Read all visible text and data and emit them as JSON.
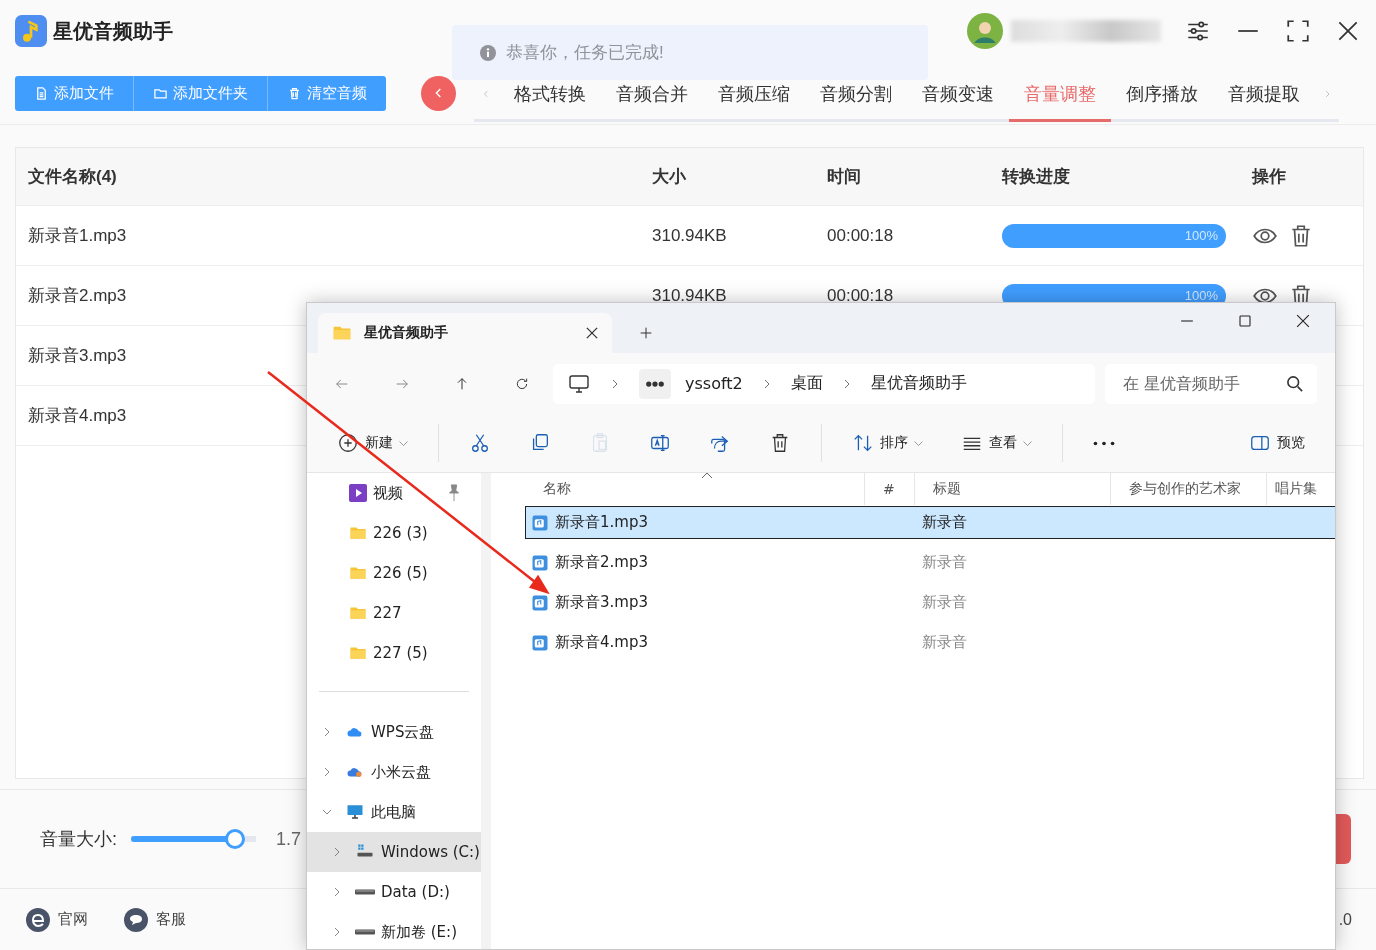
{
  "app": {
    "title": "星优音频助手",
    "toast": "恭喜你，任务已完成!",
    "actions": [
      {
        "label": "添加文件",
        "kind": "file"
      },
      {
        "label": "添加文件夹",
        "kind": "folder"
      },
      {
        "label": "清空音频",
        "kind": "trash"
      }
    ],
    "tabs": [
      {
        "label": "格式转换",
        "selected": false
      },
      {
        "label": "音频合并",
        "selected": false
      },
      {
        "label": "音频压缩",
        "selected": false
      },
      {
        "label": "音频分割",
        "selected": false
      },
      {
        "label": "音频变速",
        "selected": false
      },
      {
        "label": "音量调整",
        "selected": true
      },
      {
        "label": "倒序播放",
        "selected": false
      },
      {
        "label": "音频提取",
        "selected": false
      }
    ],
    "table": {
      "columns": [
        "文件名称(4)",
        "大小",
        "时间",
        "转换进度",
        "操作"
      ],
      "rows": [
        {
          "name": "新录音1.mp3",
          "size": "310.94KB",
          "time": "00:00:18",
          "progress": "100%",
          "level": 1
        },
        {
          "name": "新录音2.mp3",
          "size": "310.94KB",
          "time": "00:00:18",
          "progress": "100%",
          "level": 1
        },
        {
          "name": "新录音3.mp3"
        },
        {
          "name": "新录音4.mp3"
        }
      ]
    },
    "volume": {
      "label": "音量大小:",
      "level": 0.83,
      "reading": "1.7"
    },
    "footer": {
      "links": [
        {
          "label": "官网",
          "kind": "web"
        },
        {
          "label": "客服",
          "kind": "chat"
        }
      ],
      "version": ".0"
    }
  },
  "explorer": {
    "tab_title": "星优音频助手",
    "breadcrumb": [
      "yssoft2",
      "桌面",
      "星优音频助手"
    ],
    "search": {
      "placeholder": "在 星优音频助手"
    },
    "toolbar": [
      {
        "kind": "new",
        "label": "新建",
        "dropdown": true,
        "disabled": false
      },
      {
        "kind": "cut",
        "dropdown": false,
        "disabled": false
      },
      {
        "kind": "copy",
        "dropdown": false,
        "disabled": false
      },
      {
        "kind": "paste",
        "dropdown": false,
        "disabled": true
      },
      {
        "kind": "rename",
        "dropdown": false,
        "disabled": false
      },
      {
        "kind": "share",
        "dropdown": false,
        "disabled": false
      },
      {
        "kind": "delete",
        "dropdown": false,
        "disabled": false
      },
      {
        "kind": "sort",
        "label": "排序",
        "dropdown": true,
        "disabled": false
      },
      {
        "kind": "view",
        "label": "查看",
        "dropdown": true,
        "disabled": false
      },
      {
        "kind": "more",
        "dropdown": false,
        "disabled": false
      },
      {
        "kind": "preview",
        "label": "预览",
        "dropdown": false,
        "disabled": false
      }
    ],
    "quick_access": [
      {
        "label": "视频",
        "kind": "video",
        "pinned": true
      },
      {
        "label": "226 (3)",
        "kind": "folder",
        "pinned": false
      },
      {
        "label": "226 (5)",
        "kind": "folder",
        "pinned": false
      },
      {
        "label": "227",
        "kind": "folder",
        "pinned": false
      },
      {
        "label": "227 (5)",
        "kind": "folder",
        "pinned": false
      }
    ],
    "tree": [
      {
        "label": "WPS云盘",
        "kind": "cloud",
        "expanded": false,
        "selected": false
      },
      {
        "label": "小米云盘",
        "kind": "cloud2",
        "expanded": false,
        "selected": false
      },
      {
        "label": "此电脑",
        "kind": "pc",
        "expanded": true,
        "selected": false,
        "children": [
          {
            "label": "Windows (C:)",
            "kind": "osdrive",
            "expanded": false,
            "selected": true
          },
          {
            "label": "Data (D:)",
            "kind": "drive",
            "expanded": false,
            "selected": false
          },
          {
            "label": "新加卷 (E:)",
            "kind": "drive",
            "expanded": false,
            "selected": false
          }
        ]
      }
    ],
    "columns": [
      "名称",
      "#",
      "标题",
      "参与创作的艺术家",
      "唱片集"
    ],
    "files": [
      {
        "name": "新录音1.mp3",
        "title": "新录音",
        "selected": true
      },
      {
        "name": "新录音2.mp3",
        "title": "新录音",
        "selected": false
      },
      {
        "name": "新录音3.mp3",
        "title": "新录音",
        "selected": false
      },
      {
        "name": "新录音4.mp3",
        "title": "新录音",
        "selected": false
      }
    ]
  }
}
